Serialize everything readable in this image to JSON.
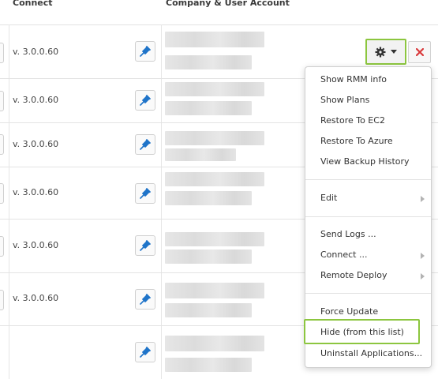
{
  "header": {
    "connect": "Connect",
    "company_account": "Company & User Account"
  },
  "rows": [
    {
      "version": "v. 3.0.0.60"
    },
    {
      "version": "v. 3.0.0.60"
    },
    {
      "version": "v. 3.0.0.60"
    },
    {
      "version": "v. 3.0.0.60"
    },
    {
      "version": "v. 3.0.0.60"
    },
    {
      "version": "v. 3.0.0.60"
    },
    {
      "version": ""
    }
  ],
  "icons": {
    "connect": "plug-icon",
    "settings": "gear-icon",
    "dropdown": "caret-down-icon",
    "remove": "close-icon"
  },
  "menu": {
    "show_rmm_info": "Show RMM info",
    "show_plans": "Show Plans",
    "restore_ec2": "Restore To EC2",
    "restore_azure": "Restore To Azure",
    "view_backup_history": "View Backup History",
    "edit": "Edit",
    "send_logs": "Send Logs ...",
    "connect": "Connect ...",
    "remote_deploy": "Remote Deploy",
    "force_update": "Force Update",
    "hide": "Hide (from this list)",
    "uninstall": "Uninstall Applications..."
  },
  "colors": {
    "highlight": "#8cc63f",
    "plug_blue": "#1f74c9",
    "close_red": "#d9383a"
  }
}
